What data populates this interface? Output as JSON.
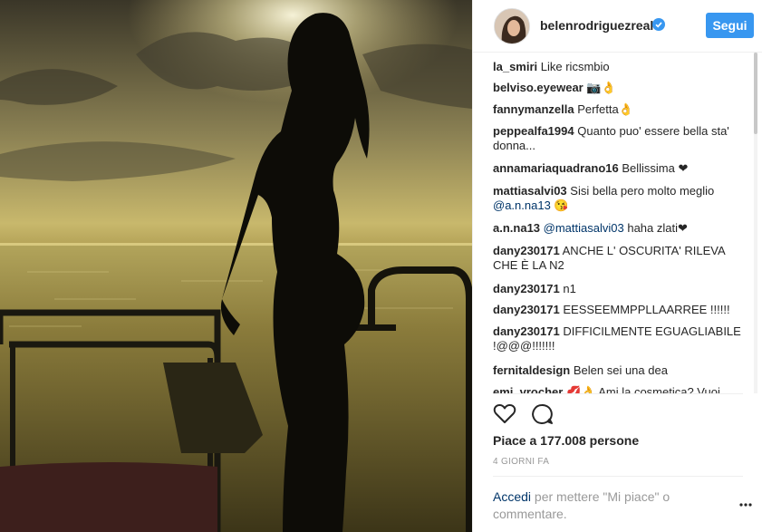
{
  "post": {
    "username": "belenrodriguezreal",
    "follow_label": "Segui",
    "likes_text": "Piace a 177.008 persone",
    "timestamp": "4 GIORNI FA",
    "login_link": "Accedi",
    "login_text": " per mettere \"Mi piace\" o commentare."
  },
  "comments": [
    {
      "user": "la_smiri",
      "text": " Like ricsmbio"
    },
    {
      "user": "belviso.eyewear",
      "text": " 📷👌"
    },
    {
      "user": "fannymanzella",
      "text": " Perfetta👌"
    },
    {
      "user": "peppealfa1994",
      "text": " Quanto puo' essere bella sta' donna..."
    },
    {
      "user": "annamariaquadrano16",
      "text": " Bellissima ❤"
    },
    {
      "user": "mattiasalvi03",
      "text": " Sisi bella pero molto meglio ",
      "mention": "@a.n.na13",
      "after": " 😘"
    },
    {
      "user": "a.n.na13",
      "text": " ",
      "mention": "@mattiasalvi03",
      "after": " haha zlati❤"
    },
    {
      "user": "dany230171",
      "text": " ANCHE L' OSCURITA' RILEVA CHE È LA N2"
    },
    {
      "user": "dany230171",
      "text": " n1"
    },
    {
      "user": "dany230171",
      "text": " EESSEEMMPPLLAARREE !!!!!!"
    },
    {
      "user": "dany230171",
      "text": " DIFFICILMENTE EGUAGLIABILE !@@@!!!!!!!"
    },
    {
      "user": "fernitaldesign",
      "text": " Belen sei una dea"
    },
    {
      "user": "emi_vrocher",
      "text": " 💋👌 Ami la cosmetica? Vuoi"
    }
  ],
  "icons": {
    "verified": "verified-badge-icon",
    "like": "heart-outline-icon",
    "comment": "speech-bubble-icon",
    "more": "more-options-icon"
  },
  "colors": {
    "accent": "#3897f0",
    "link": "#003569",
    "text": "#262626",
    "muted": "#999999"
  }
}
